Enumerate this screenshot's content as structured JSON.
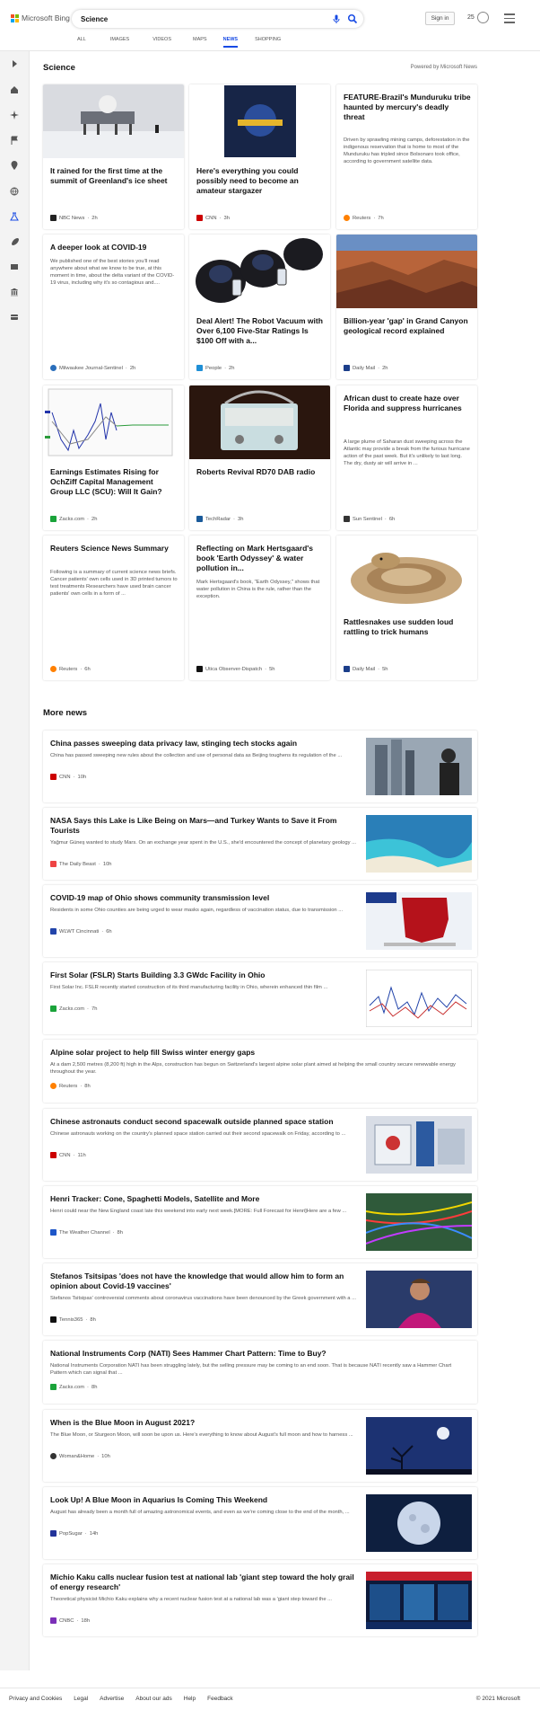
{
  "brand": {
    "name": "Microsoft Bing"
  },
  "search": {
    "value": "Science"
  },
  "header": {
    "sign_in": "Sign in",
    "rewards": "25"
  },
  "tabs": [
    "ALL",
    "IMAGES",
    "VIDEOS",
    "MAPS",
    "NEWS",
    "SHOPPING"
  ],
  "active_tab": "NEWS",
  "section": {
    "title": "Science",
    "powered": "Powered by Microsoft News"
  },
  "cards": [
    {
      "title": "It rained for the first time at the summit of Greenland's ice sheet",
      "desc": "",
      "source": "NBC News",
      "time": "2h",
      "source_color": "#222"
    },
    {
      "title": "Here's everything you could possibly need to become an amateur stargazer",
      "desc": "",
      "source": "CNN",
      "time": "3h",
      "source_color": "#cc0000"
    },
    {
      "title": "FEATURE-Brazil's Munduruku tribe haunted by mercury's deadly threat",
      "desc": "Driven by sprawling mining camps, deforestation in the indigenous reservation that is home to most of the Munduruku has tripled since Bolsonaro took office, according to government satellite data.",
      "source": "Reuters",
      "time": "7h",
      "source_color": "#ff8000"
    },
    {
      "title": "A deeper look at COVID-19",
      "desc": "We published one of the best stories you'll read anywhere about what we know to be true, at this moment in time, about the delta variant of the COVID-19 virus, including why it's so contagious and....",
      "source": "Milwaukee Journal-Sentinel",
      "time": "2h",
      "source_color": "#2a6ebb"
    },
    {
      "title": "Deal Alert! The Robot Vacuum with Over 6,100 Five-Star Ratings Is $100 Off with a...",
      "desc": "",
      "source": "People",
      "time": "2h",
      "source_color": "#1f8fd6"
    },
    {
      "title": "Billion-year 'gap' in Grand Canyon geological record explained",
      "desc": "",
      "source": "Daily Mail",
      "time": "2h",
      "source_color": "#1b3e8a"
    },
    {
      "title": "Earnings Estimates Rising for OchZiff Capital Management Group LLC (SCU): Will It Gain?",
      "desc": "",
      "source": "Zacks.com",
      "time": "2h",
      "source_color": "#1aa33a"
    },
    {
      "title": "Roberts Revival RD70 DAB radio",
      "desc": "",
      "source": "TechRadar",
      "time": "3h",
      "source_color": "#1a5a9a"
    },
    {
      "title": "African dust to create haze over Florida and suppress hurricanes",
      "desc": "A large plume of Saharan dust sweeping across the Atlantic may provide a break from the furious hurricane action of the past week. But it's unlikely to last long. The dry, dusty air will arrive in ...",
      "source": "Sun Sentinel",
      "time": "6h",
      "source_color": "#333"
    },
    {
      "title": "Reuters Science News Summary",
      "desc": "Following is a summary of current science news briefs. Cancer patients' own cells used in 3D printed tumors to test treatments Researchers have used brain cancer patients' own cells in a form of ...",
      "source": "Reuters",
      "time": "6h",
      "source_color": "#ff8000"
    },
    {
      "title": "Reflecting on Mark Hertsgaard's book 'Earth Odyssey' & water pollution in...",
      "desc": "Mark Hertsgaard's book, \"Earth Odyssey,\" shows that water pollution in China is the rule, rather than the exception.",
      "source": "Utica Observer-Dispatch",
      "time": "5h",
      "source_color": "#111"
    },
    {
      "title": "Rattlesnakes use sudden loud rattling to trick humans",
      "desc": "",
      "source": "Daily Mail",
      "time": "5h",
      "source_color": "#1b3e8a"
    }
  ],
  "more_news": {
    "title": "More news",
    "items": [
      {
        "title": "China passes sweeping data privacy law, stinging tech stocks again",
        "desc": "China has passed sweeping new rules about the collection and use of personal data as Beijing toughens its regulation of the ...",
        "source": "CNN",
        "time": "10h",
        "source_color": "#cc0000"
      },
      {
        "title": "NASA Says this Lake is Like Being on Mars—and Turkey Wants to Save it From Tourists",
        "desc": "Yağmur Güneş wanted to study Mars. On an exchange year spent in the U.S., she'd encountered the concept of planetary geology ...",
        "source": "The Daily Beast",
        "time": "10h",
        "source_color": "#e44"
      },
      {
        "title": "COVID-19 map of Ohio shows community transmission level",
        "desc": "Residents in some Ohio counties are being urged to wear masks again, regardless of vaccination status, due to transmission ...",
        "source": "WLWT Cincinnati",
        "time": "6h",
        "source_color": "#2244aa"
      },
      {
        "title": "First Solar (FSLR) Starts Building 3.3 GWdc Facility in Ohio",
        "desc": "First Solar Inc. FSLR recently started construction of its third manufacturing facility in Ohio, wherein enhanced thin film ...",
        "source": "Zacks.com",
        "time": "7h",
        "source_color": "#1aa33a"
      },
      {
        "title": "Alpine solar project to help fill Swiss winter energy gaps",
        "desc": "At a dam 2,500 metres (8,200 ft) high in the Alps, construction has begun on Switzerland's largest alpine solar plant aimed at helping the small country secure renewable energy throughout the year.",
        "source": "Reuters",
        "time": "8h",
        "source_color": "#ff8000"
      },
      {
        "title": "Chinese astronauts conduct second spacewalk outside planned space station",
        "desc": "Chinese astronauts working on the country's planned space station carried out their second spacewalk on Friday, according to ...",
        "source": "CNN",
        "time": "11h",
        "source_color": "#cc0000"
      },
      {
        "title": "Henri Tracker: Cone, Spaghetti Models, Satellite and More",
        "desc": "Henri could near the New England coast late this weekend into early next week.[MORE: Full Forecast for Henri]Here are a few ...",
        "source": "The Weather Channel",
        "time": "8h",
        "source_color": "#1e56c8"
      },
      {
        "title": "Stefanos Tsitsipas 'does not have the knowledge that would allow him to form an opinion about Covid-19 vaccines'",
        "desc": "Stefanos Tsitsipas' controversial comments about coronavirus vaccinations have been denounced by the Greek government with a ...",
        "source": "Tennis365",
        "time": "8h",
        "source_color": "#111"
      },
      {
        "title": "National Instruments Corp (NATI) Sees Hammer Chart Pattern: Time to Buy?",
        "desc": "National Instruments Corporation NATI has been struggling lately, but the selling pressure may be coming to an end soon. That is because NATI recently saw a Hammer Chart Pattern which can signal that ...",
        "source": "Zacks.com",
        "time": "8h",
        "source_color": "#1aa33a"
      },
      {
        "title": "When is the Blue Moon in August 2021?",
        "desc": "The Blue Moon, or Sturgeon Moon, will soon be upon us. Here's everything to know about August's full moon and how to harness ...",
        "source": "Woman&Home",
        "time": "10h",
        "source_color": "#333"
      },
      {
        "title": "Look Up! A Blue Moon in Aquarius Is Coming This Weekend",
        "desc": "August has already been a month full of amazing astronomical events, and even as we're coming close to the end of the month, ...",
        "source": "PopSugar",
        "time": "14h",
        "source_color": "#223399"
      },
      {
        "title": "Michio Kaku calls nuclear fusion test at national lab 'giant step toward the holy grail of energy research'",
        "desc": "Theoretical physicist Michio Kaku explains why a recent nuclear fusion test at a national lab was a 'giant step toward the ...",
        "source": "CNBC",
        "time": "18h",
        "source_color": "#7b2fb8"
      }
    ]
  },
  "footer": {
    "links": [
      "Privacy and Cookies",
      "Legal",
      "Advertise",
      "About our ads",
      "Help",
      "Feedback"
    ],
    "copyright": "© 2021 Microsoft"
  }
}
